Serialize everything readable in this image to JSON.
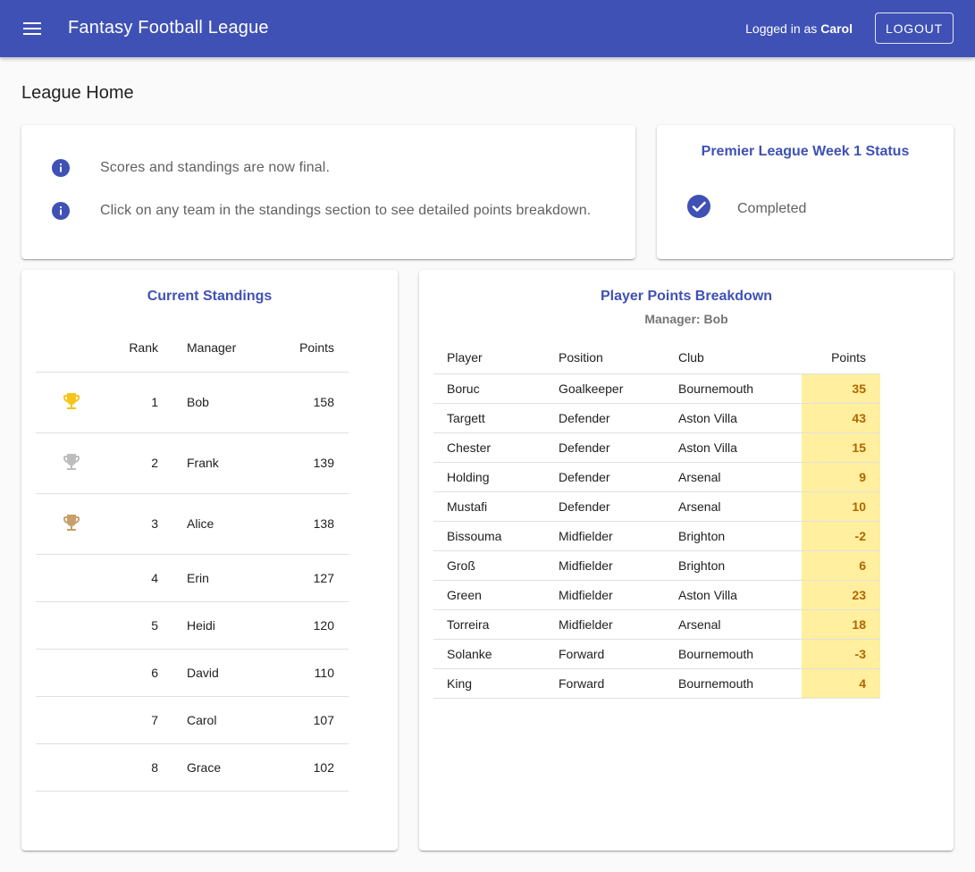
{
  "app": {
    "title": "Fantasy Football League",
    "logged_in_prefix": "Logged in as",
    "user": "Carol",
    "logout_label": "LOGOUT",
    "brand_color": "#3f51b5"
  },
  "page": {
    "title": "League Home"
  },
  "info": {
    "icon": "info-icon",
    "messages": [
      "Scores and standings are now final.",
      "Click on any team in the standings section to see detailed points breakdown."
    ]
  },
  "status": {
    "heading": "Premier League Week 1 Status",
    "icon": "check-circle-icon",
    "text": "Completed"
  },
  "standings": {
    "heading": "Current Standings",
    "columns": {
      "rank": "Rank",
      "manager": "Manager",
      "points": "Points"
    },
    "trophy_colors": {
      "gold": "#f5c518",
      "silver": "#bdbdbd",
      "bronze": "#c9a06a"
    },
    "rows": [
      {
        "trophy": "gold",
        "rank": "1",
        "manager": "Bob",
        "points": "158"
      },
      {
        "trophy": "silver",
        "rank": "2",
        "manager": "Frank",
        "points": "139"
      },
      {
        "trophy": "bronze",
        "rank": "3",
        "manager": "Alice",
        "points": "138"
      },
      {
        "trophy": "",
        "rank": "4",
        "manager": "Erin",
        "points": "127"
      },
      {
        "trophy": "",
        "rank": "5",
        "manager": "Heidi",
        "points": "120"
      },
      {
        "trophy": "",
        "rank": "6",
        "manager": "David",
        "points": "110"
      },
      {
        "trophy": "",
        "rank": "7",
        "manager": "Carol",
        "points": "107"
      },
      {
        "trophy": "",
        "rank": "8",
        "manager": "Grace",
        "points": "102"
      }
    ]
  },
  "breakdown": {
    "heading": "Player Points Breakdown",
    "manager_label": "Manager: Bob",
    "columns": {
      "player": "Player",
      "position": "Position",
      "club": "Club",
      "points": "Points"
    },
    "highlight_color": "#ffef9e",
    "rows": [
      {
        "player": "Boruc",
        "position": "Goalkeeper",
        "club": "Bournemouth",
        "points": "35"
      },
      {
        "player": "Targett",
        "position": "Defender",
        "club": "Aston Villa",
        "points": "43"
      },
      {
        "player": "Chester",
        "position": "Defender",
        "club": "Aston Villa",
        "points": "15"
      },
      {
        "player": "Holding",
        "position": "Defender",
        "club": "Arsenal",
        "points": "9"
      },
      {
        "player": "Mustafi",
        "position": "Defender",
        "club": "Arsenal",
        "points": "10"
      },
      {
        "player": "Bissouma",
        "position": "Midfielder",
        "club": "Brighton",
        "points": "-2"
      },
      {
        "player": "Groß",
        "position": "Midfielder",
        "club": "Brighton",
        "points": "6"
      },
      {
        "player": "Green",
        "position": "Midfielder",
        "club": "Aston Villa",
        "points": "23"
      },
      {
        "player": "Torreira",
        "position": "Midfielder",
        "club": "Arsenal",
        "points": "18"
      },
      {
        "player": "Solanke",
        "position": "Forward",
        "club": "Bournemouth",
        "points": "-3"
      },
      {
        "player": "King",
        "position": "Forward",
        "club": "Bournemouth",
        "points": "4"
      }
    ]
  }
}
